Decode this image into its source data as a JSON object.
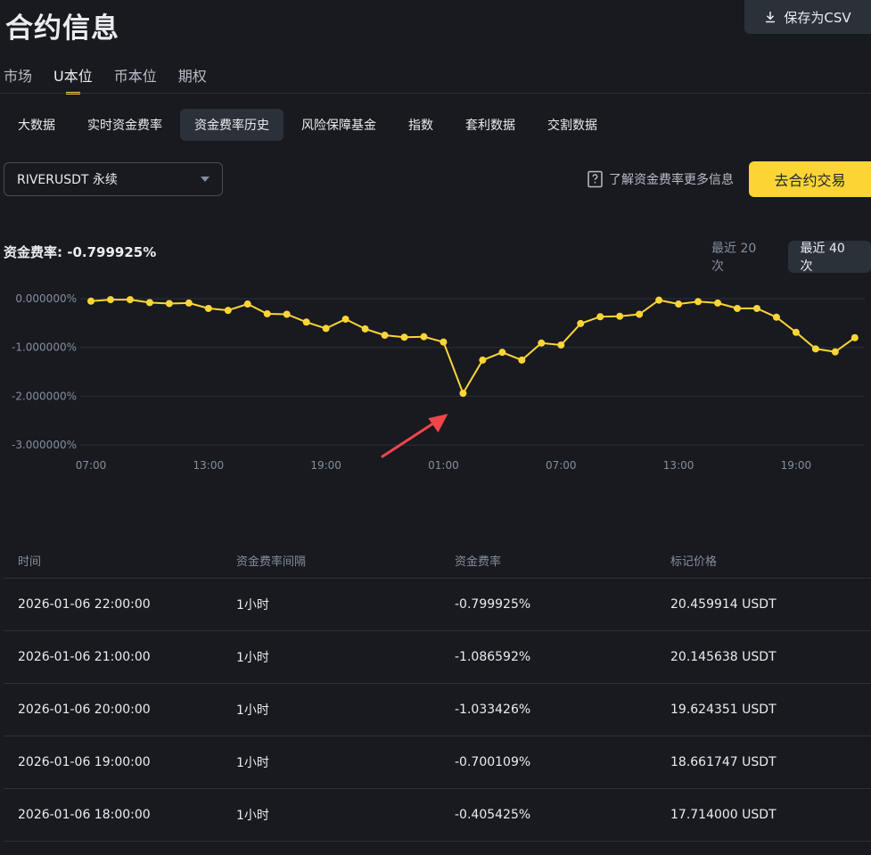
{
  "page": {
    "title": "合约信息"
  },
  "toolbar": {
    "csv_label": "保存为CSV"
  },
  "market_tabs": [
    {
      "label": "市场",
      "active": false
    },
    {
      "label": "U本位",
      "active": true
    },
    {
      "label": "币本位",
      "active": false
    },
    {
      "label": "期权",
      "active": false
    }
  ],
  "sub_tabs": [
    {
      "label": "大数据",
      "active": false
    },
    {
      "label": "实时资金费率",
      "active": false
    },
    {
      "label": "资金费率历史",
      "active": true
    },
    {
      "label": "风险保障基金",
      "active": false
    },
    {
      "label": "指数",
      "active": false
    },
    {
      "label": "套利数据",
      "active": false
    },
    {
      "label": "交割数据",
      "active": false
    }
  ],
  "symbol_select": {
    "value": "RIVERUSDT 永续"
  },
  "info_link": {
    "label": "了解资金费率更多信息"
  },
  "trade_button": {
    "label": "去合约交易"
  },
  "funding_rate": {
    "label": "资金费率: -0.799925%"
  },
  "range_toggle": {
    "recent20": "最近 20 次",
    "recent40": "最近 40 次",
    "active": "recent40"
  },
  "colors": {
    "accent": "#fcd535",
    "annotation_arrow": "#f0464a",
    "background": "#181a20"
  },
  "chart_data": {
    "type": "line",
    "x_tick_labels": [
      "07:00",
      "13:00",
      "19:00",
      "01:00",
      "07:00",
      "13:00",
      "19:00"
    ],
    "x_tick_index": [
      0,
      6,
      12,
      18,
      24,
      30,
      36
    ],
    "y_ticks": [
      0,
      -1,
      -2,
      -3
    ],
    "y_tick_labels": [
      "0.000000%",
      "-1.000000%",
      "-2.000000%",
      "-3.000000%"
    ],
    "ylim": [
      -3,
      0
    ],
    "grid": true,
    "values": [
      -0.05,
      -0.02,
      -0.02,
      -0.08,
      -0.1,
      -0.09,
      -0.2,
      -0.24,
      -0.11,
      -0.31,
      -0.32,
      -0.48,
      -0.61,
      -0.42,
      -0.62,
      -0.75,
      -0.79,
      -0.78,
      -0.89,
      -1.94,
      -1.26,
      -1.1,
      -1.26,
      -0.91,
      -0.95,
      -0.51,
      -0.37,
      -0.36,
      -0.32,
      -0.03,
      -0.11,
      -0.06,
      -0.09,
      -0.2,
      -0.2,
      -0.38,
      -0.69,
      -1.03,
      -1.09,
      -0.8
    ],
    "annotation": {
      "type": "arrow",
      "target_index": 19
    }
  },
  "table": {
    "headers": [
      "时间",
      "资金费率间隔",
      "资金费率",
      "标记价格"
    ],
    "rows": [
      [
        "2026-01-06 22:00:00",
        "1小时",
        "-0.799925%",
        "20.459914 USDT"
      ],
      [
        "2026-01-06 21:00:00",
        "1小时",
        "-1.086592%",
        "20.145638 USDT"
      ],
      [
        "2026-01-06 20:00:00",
        "1小时",
        "-1.033426%",
        "19.624351 USDT"
      ],
      [
        "2026-01-06 19:00:00",
        "1小时",
        "-0.700109%",
        "18.661747 USDT"
      ],
      [
        "2026-01-06 18:00:00",
        "1小时",
        "-0.405425%",
        "17.714000 USDT"
      ]
    ]
  }
}
